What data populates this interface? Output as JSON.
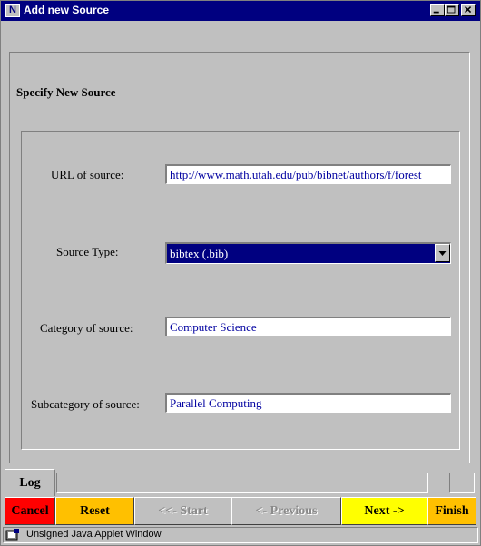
{
  "window": {
    "title": "Add new Source",
    "app_icon": "N",
    "controls": [
      "minimize-icon",
      "maximize-icon",
      "close-icon"
    ]
  },
  "section_title": "Specify New Source",
  "form": {
    "url": {
      "label": "URL of source:",
      "value": "http://www.math.utah.edu/pub/bibnet/authors/f/forest"
    },
    "source_type": {
      "label": "Source Type:",
      "value": "bibtex  (.bib)"
    },
    "category": {
      "label": "Category of source:",
      "value": "Computer Science"
    },
    "subcategory": {
      "label": "Subcategory of source:",
      "value": "Parallel Computing"
    }
  },
  "log": {
    "tab_label": "Log"
  },
  "buttons": {
    "cancel": {
      "label": "Cancel",
      "color": "#ff0000"
    },
    "reset": {
      "label": "Reset",
      "color": "#ffc000"
    },
    "start": {
      "label": "<<- Start",
      "color": "#c0c0c0"
    },
    "previous": {
      "label": "<- Previous",
      "color": "#c0c0c0"
    },
    "next": {
      "label": "Next ->",
      "color": "#ffff00"
    },
    "finish": {
      "label": "Finish",
      "color": "#ffc000"
    }
  },
  "status": {
    "text": "Unsigned Java Applet Window"
  },
  "colors": {
    "titlebar": "#000080",
    "face": "#c0c0c0",
    "field_text": "#0000a0"
  }
}
